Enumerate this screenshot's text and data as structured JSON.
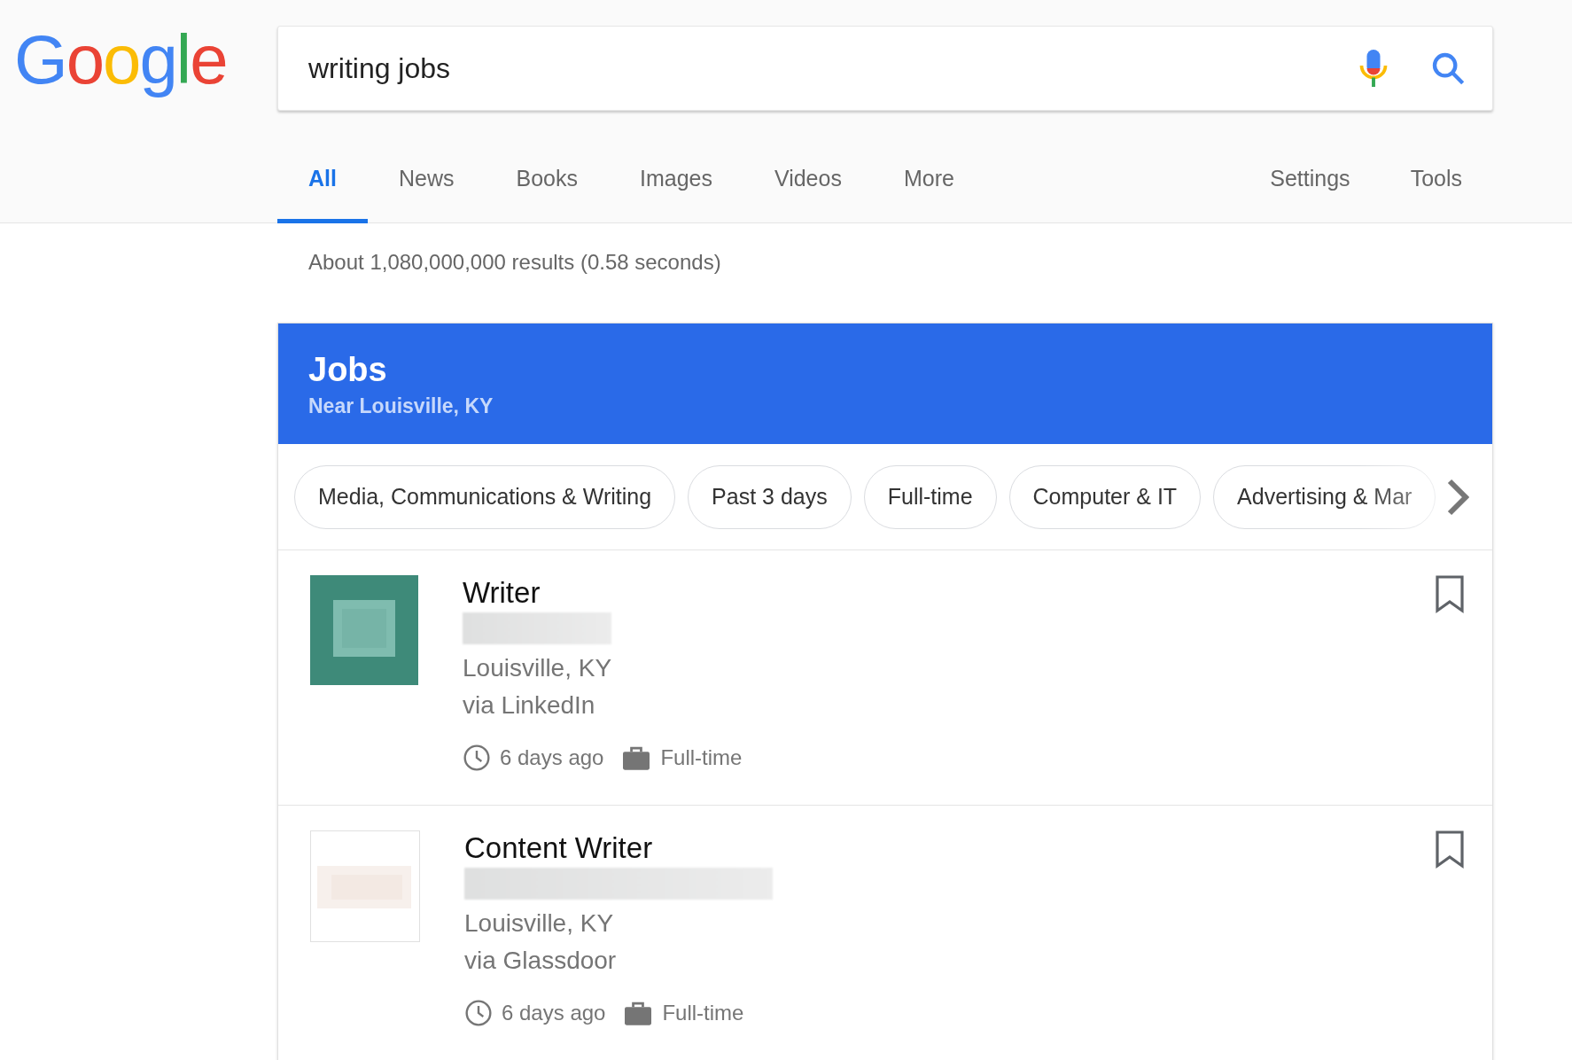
{
  "logo": [
    {
      "letter": "G",
      "color": "#4285f4"
    },
    {
      "letter": "o",
      "color": "#ea4335"
    },
    {
      "letter": "o",
      "color": "#fbbc05"
    },
    {
      "letter": "g",
      "color": "#4285f4"
    },
    {
      "letter": "l",
      "color": "#34a853"
    },
    {
      "letter": "e",
      "color": "#ea4335"
    }
  ],
  "search": {
    "value": "writing jobs"
  },
  "tabs": [
    {
      "label": "All",
      "selected": true
    },
    {
      "label": "News",
      "selected": false
    },
    {
      "label": "Books",
      "selected": false
    },
    {
      "label": "Images",
      "selected": false
    },
    {
      "label": "Videos",
      "selected": false
    },
    {
      "label": "More",
      "selected": false
    }
  ],
  "tools": [
    "Settings",
    "Tools"
  ],
  "result_stats": "About 1,080,000,000 results (0.58 seconds)",
  "jobs": {
    "title": "Jobs",
    "subtitle": "Near Louisville, KY",
    "chips": [
      {
        "label": "Media, Communications & Writing"
      },
      {
        "label": "Past 3 days"
      },
      {
        "label": "Full-time"
      },
      {
        "label": "Computer & IT"
      },
      {
        "label": "Advertising & Mar"
      }
    ],
    "listings": [
      {
        "title": "Writer",
        "location": "Louisville, KY",
        "source": "via LinkedIn",
        "posted": "6 days ago",
        "type": "Full-time",
        "kind": "square"
      },
      {
        "title": "Content Writer",
        "location": "Louisville, KY",
        "source": "via Glassdoor",
        "posted": "6 days ago",
        "type": "Full-time",
        "kind": "blank"
      }
    ]
  }
}
